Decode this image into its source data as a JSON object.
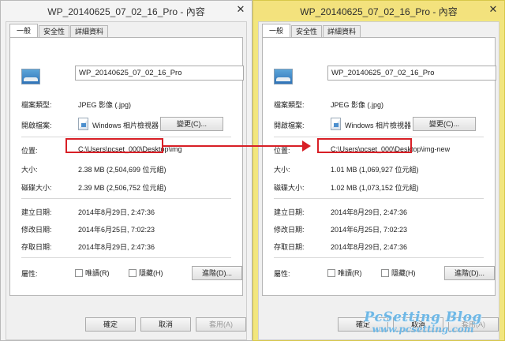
{
  "windows": {
    "left": {
      "title": "WP_20140625_07_02_16_Pro - 內容",
      "tabs": [
        "一般",
        "安全性",
        "詳細資料"
      ],
      "filename": "WP_20140625_07_02_16_Pro",
      "labels": {
        "file_type": "檔案類型:",
        "opens_with": "開啟檔案:",
        "location": "位置:",
        "size": "大小:",
        "size_on_disk": "磁碟大小:",
        "created": "建立日期:",
        "modified": "修改日期:",
        "accessed": "存取日期:",
        "attributes": "屬性:"
      },
      "file_type": "JPEG 影像 (.jpg)",
      "opens_with_app": "Windows 相片檢視器",
      "change_button": "變更(C)...",
      "location": "C:\\Users\\pcset_000\\Desktop\\img",
      "size": "2.38 MB (2,504,699 位元組)",
      "size_on_disk": "2.39 MB (2,506,752 位元組)",
      "created": "2014年8月29日, 2:47:36",
      "modified": "2014年6月25日, 7:02:23",
      "accessed": "2014年8月29日, 2:47:36",
      "readonly_label": "唯讀(R)",
      "hidden_label": "隱藏(H)",
      "advanced_button": "進階(D)...",
      "ok_button": "確定",
      "cancel_button": "取消",
      "apply_button": "套用(A)"
    },
    "right": {
      "title": "WP_20140625_07_02_16_Pro - 內容",
      "tabs": [
        "一般",
        "安全性",
        "詳細資料"
      ],
      "filename": "WP_20140625_07_02_16_Pro",
      "labels": {
        "file_type": "檔案類型:",
        "opens_with": "開啟檔案:",
        "location": "位置:",
        "size": "大小:",
        "size_on_disk": "磁碟大小:",
        "created": "建立日期:",
        "modified": "修改日期:",
        "accessed": "存取日期:",
        "attributes": "屬性:"
      },
      "file_type": "JPEG 影像 (.jpg)",
      "opens_with_app": "Windows 相片檢視器",
      "change_button": "變更(C)...",
      "location": "C:\\Users\\pcset_000\\Desktop\\img-new",
      "size": "1.01 MB (1,069,927 位元組)",
      "size_on_disk": "1.02 MB (1,073,152 位元組)",
      "created": "2014年8月29日, 2:47:36",
      "modified": "2014年6月25日, 7:02:23",
      "accessed": "2014年8月29日, 2:47:36",
      "readonly_label": "唯讀(R)",
      "hidden_label": "隱藏(H)",
      "advanced_button": "進階(D)...",
      "ok_button": "確定",
      "cancel_button": "取消",
      "apply_button": "套用(A)"
    }
  },
  "watermark": {
    "title": "PcSetting Blog",
    "url": "www.pcsetting.com"
  },
  "colors": {
    "highlight": "#d81f26",
    "right_frame": "#f2e67e",
    "watermark": "#6fb8e6"
  }
}
